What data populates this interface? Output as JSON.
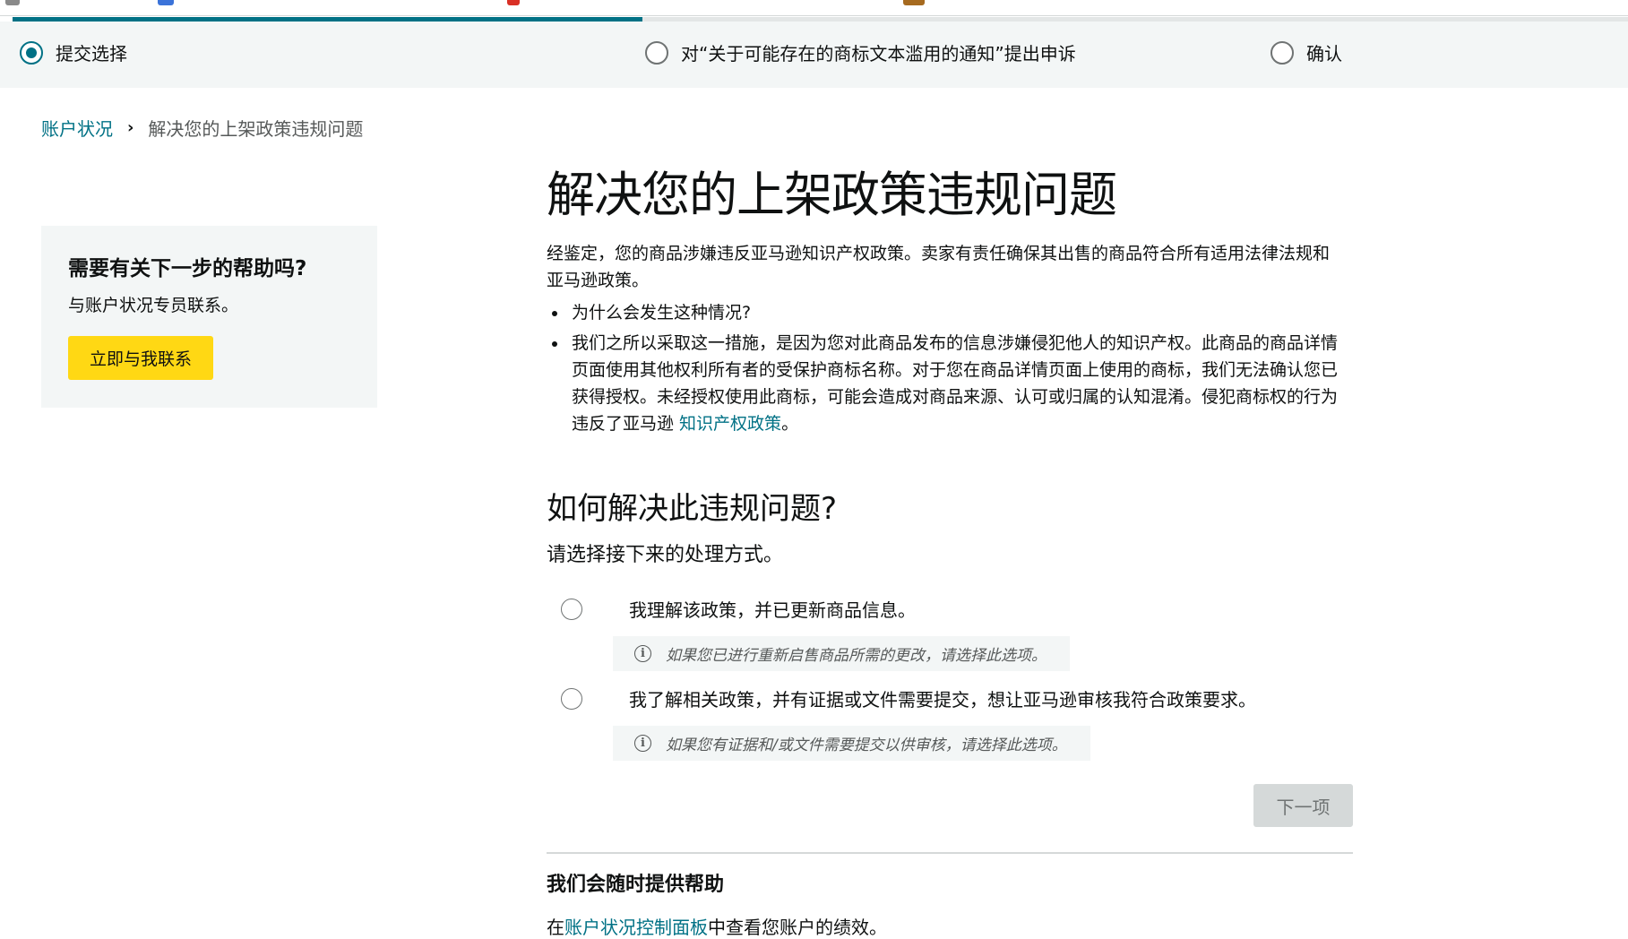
{
  "progress": {
    "fraction": 0.39
  },
  "stepper": {
    "steps": [
      {
        "label": "提交选择",
        "active": true
      },
      {
        "label": "对“关于可能存在的商标文本滥用的通知”提出申诉",
        "active": false
      },
      {
        "label": "确认",
        "active": false
      }
    ]
  },
  "breadcrumb": {
    "parent": "账户状况",
    "current": "解决您的上架政策违规问题"
  },
  "help": {
    "title": "需要有关下一步的帮助吗?",
    "text": "与账户状况专员联系。",
    "button": "立即与我联系"
  },
  "main": {
    "title": "解决您的上架政策违规问题",
    "intro": "经鉴定，您的商品涉嫌违反亚马逊知识产权政策。卖家有责任确保其出售的商品符合所有适用法律法规和亚马逊政策。",
    "bullet1": "为什么会发生这种情况?",
    "bullet2": "我们之所以采取这一措施，是因为您对此商品发布的信息涉嫌侵犯他人的知识产权。此商品的商品详情页面使用其他权利所有者的受保护商标名称。对于您在商品详情页面上使用的商标，我们无法确认您已获得授权。未经授权使用此商标，可能会造成对商品来源、认可或归属的认知混淆。侵犯商标权的行为违反了亚马逊 ",
    "bullet2_link": "知识产权政策",
    "bullet2_end": "。"
  },
  "resolve": {
    "title": "如何解决此违规问题?",
    "subtitle": "请选择接下来的处理方式。",
    "options": [
      {
        "label": "我理解该政策，并已更新商品信息。",
        "hint": "如果您已进行重新启售商品所需的更改，请选择此选项。"
      },
      {
        "label": "我了解相关政策，并有证据或文件需要提交，想让亚马逊审核我符合政策要求。",
        "hint": "如果您有证据和/或文件需要提交以供审核，请选择此选项。"
      }
    ],
    "info_glyph": "i",
    "next_button": "下一项"
  },
  "footer": {
    "title": "我们会随时提供帮助",
    "prefix": "在",
    "link": "账户状况控制面板",
    "suffix": "中查看您账户的绩效。"
  }
}
